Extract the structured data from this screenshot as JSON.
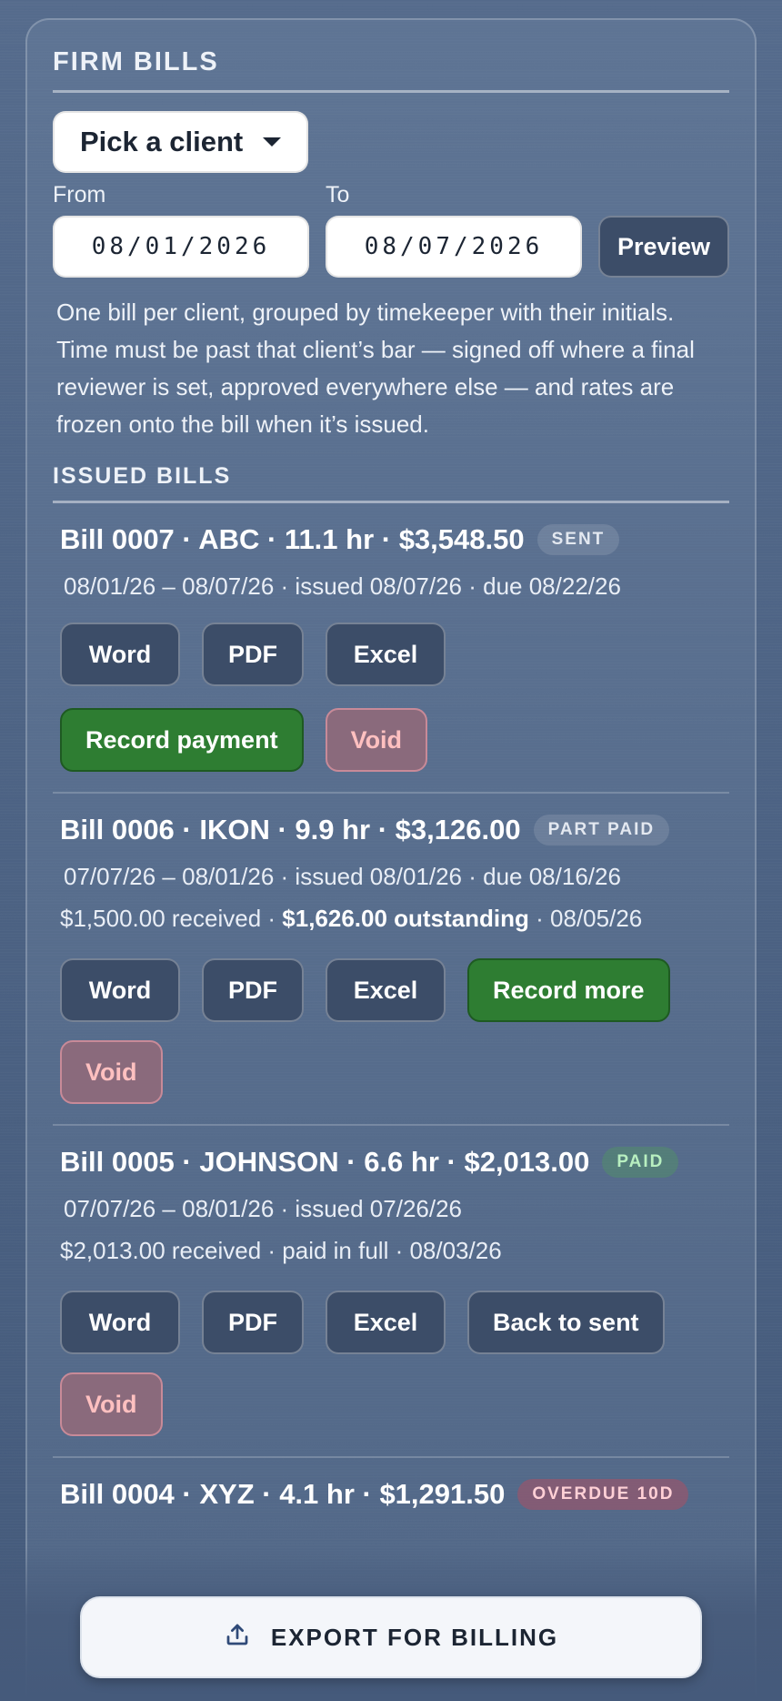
{
  "header": {
    "title": "FIRM BILLS"
  },
  "client_picker": {
    "label": "Pick a client"
  },
  "date_range": {
    "from_label": "From",
    "from_value": "08/01/2026",
    "to_label": "To",
    "to_value": "08/07/2026",
    "preview_label": "Preview"
  },
  "description": "One bill per client, grouped by timekeeper with their initials. Time must be past that client’s bar — signed off where a final reviewer is set, approved everywhere else — and rates are frozen onto the bill when it’s issued.",
  "issued": {
    "title": "ISSUED BILLS",
    "bills": [
      {
        "heading": "Bill 0007 · ABC · 11.1 hr · $3,548.50",
        "status": "SENT",
        "dates": "08/01/26 – 08/07/26 · issued 08/07/26 · due 08/22/26",
        "btn_word": "Word",
        "btn_pdf": "PDF",
        "btn_excel": "Excel",
        "btn_action": "Record payment",
        "btn_void": "Void"
      },
      {
        "heading": "Bill 0006 · IKON · 9.9 hr · $3,126.00",
        "status": "PART PAID",
        "dates": "07/07/26 – 08/01/26 · issued 08/01/26 · due 08/16/26",
        "received": "$1,500.00 received · ",
        "outstanding": "$1,626.00 outstanding",
        "received_tail": " · 08/05/26",
        "btn_word": "Word",
        "btn_pdf": "PDF",
        "btn_excel": "Excel",
        "btn_action": "Record more",
        "btn_void": "Void"
      },
      {
        "heading": "Bill 0005 · JOHNSON · 6.6 hr · $2,013.00",
        "status": "PAID",
        "dates": "07/07/26 – 08/01/26 · issued 07/26/26",
        "received": "$2,013.00 received · paid in full · 08/03/26",
        "btn_word": "Word",
        "btn_pdf": "PDF",
        "btn_excel": "Excel",
        "btn_action": "Back to sent",
        "btn_void": "Void"
      },
      {
        "heading": "Bill 0004 · XYZ · 4.1 hr · $1,291.50",
        "status": "OVERDUE 10D"
      }
    ]
  },
  "export": {
    "label": "EXPORT FOR BILLING"
  },
  "colors": {
    "accent_green": "#2e7d32",
    "void_text": "#ffc0c0",
    "background": "#4a5f80"
  }
}
